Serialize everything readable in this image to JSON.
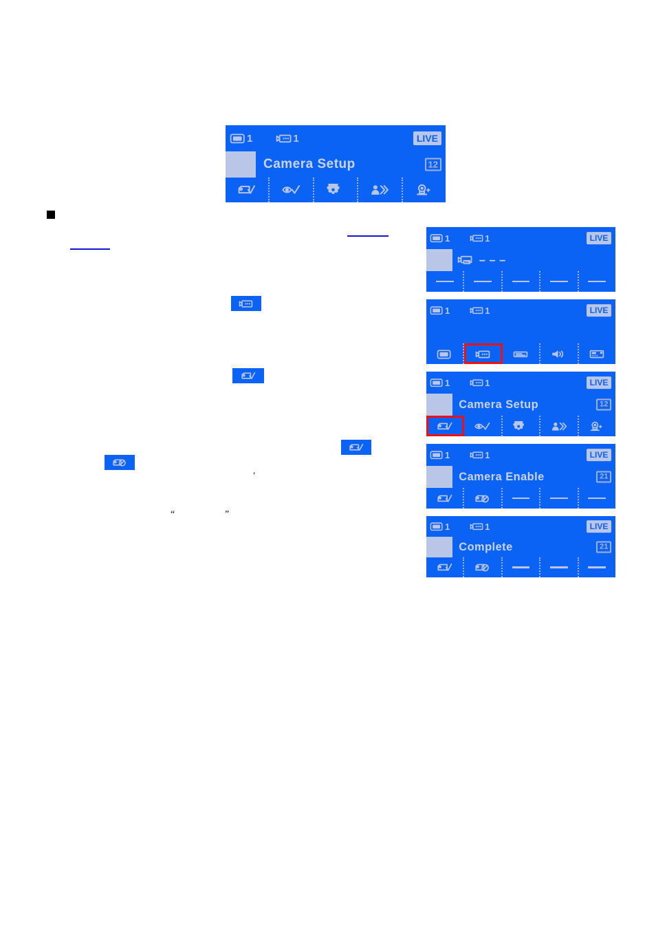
{
  "document": {
    "bullet_marker": "■",
    "quote_open": "“",
    "quote_close": "”",
    "comma": ","
  },
  "main_panel": {
    "name": "Camera Setup OSD",
    "status": {
      "monitor_icon": "monitor-icon",
      "monitor_number": "1",
      "camera_icon": "camera-icon",
      "camera_number": "1",
      "live_label": "LIVE"
    },
    "title": {
      "icon": "camera-icon",
      "text": "Camera Setup",
      "badge": "12"
    },
    "menu_icons": [
      {
        "name": "camera-check-icon",
        "selected": false
      },
      {
        "name": "eye-check-icon",
        "selected": false
      },
      {
        "name": "gear-icon",
        "selected": false
      },
      {
        "name": "person-motion-icon",
        "selected": false
      },
      {
        "name": "ptz-camera-icon",
        "selected": false
      }
    ]
  },
  "steps": [
    {
      "id": "step-camera-number",
      "status": {
        "monitor_icon": "monitor-icon",
        "monitor_number": "1",
        "camera_icon": "camera-icon",
        "camera_number": "1",
        "live_label": "LIVE"
      },
      "title": {
        "icon": "camera-icon",
        "value_icon": "camera-no-icon",
        "text": "– – –",
        "badge": ""
      },
      "menu_icons": [
        {
          "name": "blank-dash",
          "selected": false
        },
        {
          "name": "blank-dash",
          "selected": false
        },
        {
          "name": "blank-dash",
          "selected": false
        },
        {
          "name": "blank-dash",
          "selected": false
        },
        {
          "name": "blank-dash",
          "selected": false
        }
      ]
    },
    {
      "id": "step-device-select",
      "status": {
        "monitor_icon": "monitor-icon",
        "monitor_number": "1",
        "camera_icon": "camera-icon",
        "camera_number": "1",
        "live_label": "LIVE"
      },
      "title": {
        "icon": "",
        "text": "",
        "badge": ""
      },
      "menu_icons": [
        {
          "name": "monitor-icon",
          "selected": false
        },
        {
          "name": "camera-icon",
          "selected": true
        },
        {
          "name": "recorder-icon",
          "selected": false
        },
        {
          "name": "speaker-icon",
          "selected": false
        },
        {
          "name": "control-panel-icon",
          "selected": false
        }
      ]
    },
    {
      "id": "step-camera-setup",
      "status": {
        "monitor_icon": "monitor-icon",
        "monitor_number": "1",
        "camera_icon": "camera-icon",
        "camera_number": "1",
        "live_label": "LIVE"
      },
      "title": {
        "icon": "camera-icon",
        "text": "Camera Setup",
        "badge": "12"
      },
      "menu_icons": [
        {
          "name": "camera-check-icon",
          "selected": true
        },
        {
          "name": "eye-check-icon",
          "selected": false
        },
        {
          "name": "gear-icon",
          "selected": false
        },
        {
          "name": "person-motion-icon",
          "selected": false
        },
        {
          "name": "ptz-camera-icon",
          "selected": false
        }
      ]
    },
    {
      "id": "step-camera-enable",
      "status": {
        "monitor_icon": "monitor-icon",
        "monitor_number": "1",
        "camera_icon": "camera-icon",
        "camera_number": "1",
        "live_label": "LIVE"
      },
      "title": {
        "icon": "camera-icon",
        "text": "Camera Enable",
        "badge": "21"
      },
      "menu_icons": [
        {
          "name": "camera-check-icon",
          "selected": false
        },
        {
          "name": "camera-disable-icon",
          "selected": false
        },
        {
          "name": "blank-dash",
          "selected": false
        },
        {
          "name": "blank-dash",
          "selected": false
        },
        {
          "name": "blank-dash",
          "selected": false
        }
      ]
    },
    {
      "id": "step-complete",
      "status": {
        "monitor_icon": "monitor-icon",
        "monitor_number": "1",
        "camera_icon": "camera-icon",
        "camera_number": "1",
        "live_label": "LIVE"
      },
      "title": {
        "icon": "camera-icon",
        "text": "Complete",
        "badge": "21"
      },
      "menu_icons": [
        {
          "name": "camera-check-icon",
          "selected": false
        },
        {
          "name": "camera-disable-icon",
          "selected": false
        },
        {
          "name": "blank-dash",
          "selected": false
        },
        {
          "name": "blank-dash",
          "selected": false
        },
        {
          "name": "blank-dash",
          "selected": false
        }
      ]
    }
  ],
  "inline_chips": [
    {
      "id": "chip-camera",
      "icon": "camera-icon"
    },
    {
      "id": "chip-camera-check",
      "icon": "camera-check-icon"
    },
    {
      "id": "chip-camera-check-right",
      "icon": "camera-check-icon"
    },
    {
      "id": "chip-camera-disable",
      "icon": "camera-disable-icon"
    }
  ],
  "colors": {
    "osd_blue": "#0b63f6",
    "osd_light": "#b9c6e8",
    "selection_red": "#ee1111",
    "link_blue": "#1414d0"
  }
}
